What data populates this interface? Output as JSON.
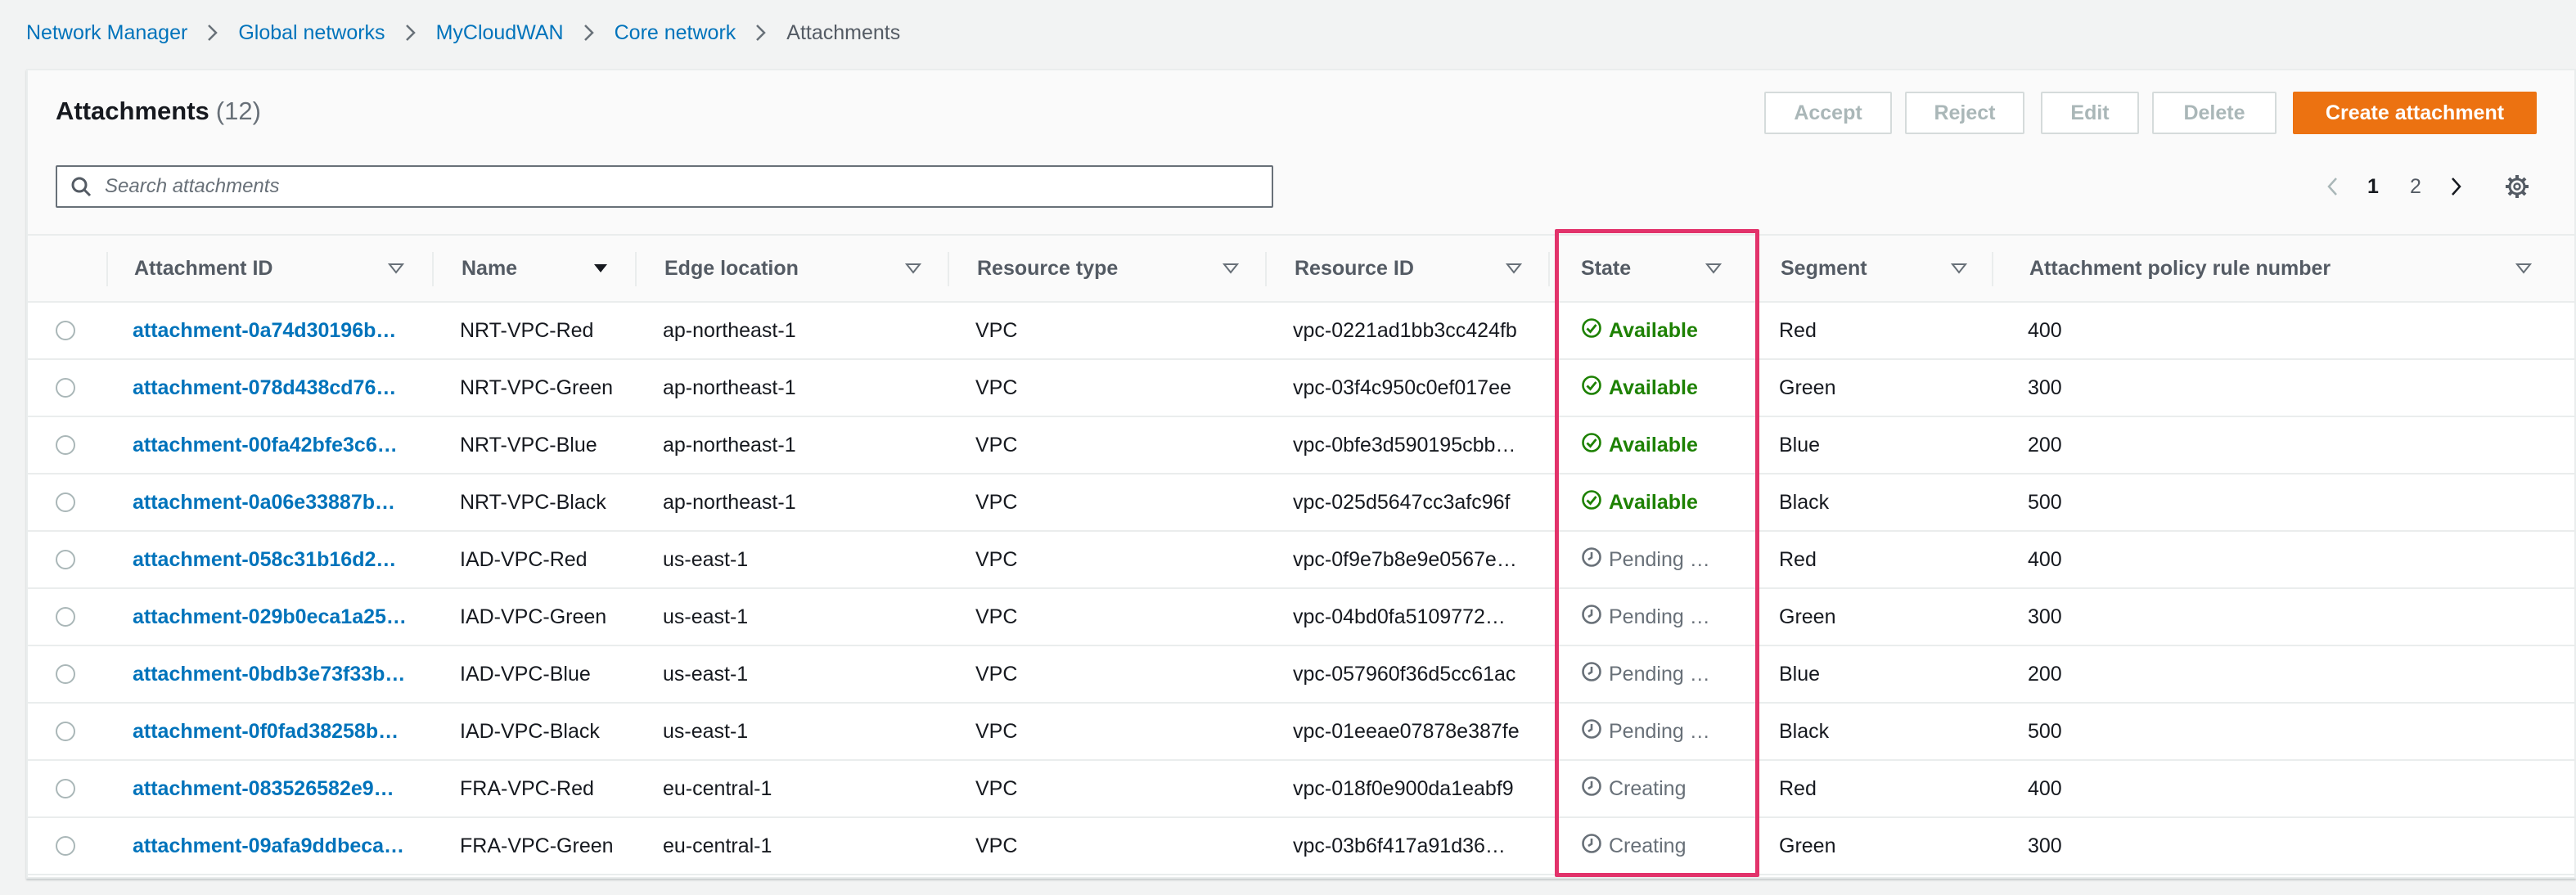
{
  "breadcrumb": {
    "items": [
      "Network Manager",
      "Global networks",
      "MyCloudWAN",
      "Core network"
    ],
    "current": "Attachments"
  },
  "panel": {
    "title": "Attachments",
    "count": "(12)"
  },
  "actions": {
    "accept": "Accept",
    "reject": "Reject",
    "edit": "Edit",
    "delete": "Delete",
    "create": "Create attachment"
  },
  "search": {
    "placeholder": "Search attachments"
  },
  "pagination": {
    "pages": [
      "1",
      "2"
    ],
    "current": "1"
  },
  "columns": {
    "attachment_id": "Attachment ID",
    "name": "Name",
    "edge_location": "Edge location",
    "resource_type": "Resource type",
    "resource_id": "Resource ID",
    "state": "State",
    "segment": "Segment",
    "policy_rule": "Attachment policy rule number"
  },
  "rows": [
    {
      "id": "attachment-0a74d30196b…",
      "name": "NRT-VPC-Red",
      "edge": "ap-northeast-1",
      "type": "VPC",
      "resource": "vpc-0221ad1bb3cc424fb",
      "state": "Available",
      "state_kind": "available",
      "segment": "Red",
      "rule": "400"
    },
    {
      "id": "attachment-078d438cd76…",
      "name": "NRT-VPC-Green",
      "edge": "ap-northeast-1",
      "type": "VPC",
      "resource": "vpc-03f4c950c0ef017ee",
      "state": "Available",
      "state_kind": "available",
      "segment": "Green",
      "rule": "300"
    },
    {
      "id": "attachment-00fa42bfe3c6…",
      "name": "NRT-VPC-Blue",
      "edge": "ap-northeast-1",
      "type": "VPC",
      "resource": "vpc-0bfe3d590195cbb…",
      "state": "Available",
      "state_kind": "available",
      "segment": "Blue",
      "rule": "200"
    },
    {
      "id": "attachment-0a06e33887b…",
      "name": "NRT-VPC-Black",
      "edge": "ap-northeast-1",
      "type": "VPC",
      "resource": "vpc-025d5647cc3afc96f",
      "state": "Available",
      "state_kind": "available",
      "segment": "Black",
      "rule": "500"
    },
    {
      "id": "attachment-058c31b16d2…",
      "name": "IAD-VPC-Red",
      "edge": "us-east-1",
      "type": "VPC",
      "resource": "vpc-0f9e7b8e9e0567e…",
      "state": "Pending …",
      "state_kind": "pending",
      "segment": "Red",
      "rule": "400"
    },
    {
      "id": "attachment-029b0eca1a25…",
      "name": "IAD-VPC-Green",
      "edge": "us-east-1",
      "type": "VPC",
      "resource": "vpc-04bd0fa5109772…",
      "state": "Pending …",
      "state_kind": "pending",
      "segment": "Green",
      "rule": "300"
    },
    {
      "id": "attachment-0bdb3e73f33b…",
      "name": "IAD-VPC-Blue",
      "edge": "us-east-1",
      "type": "VPC",
      "resource": "vpc-057960f36d5cc61ac",
      "state": "Pending …",
      "state_kind": "pending",
      "segment": "Blue",
      "rule": "200"
    },
    {
      "id": "attachment-0f0fad38258b…",
      "name": "IAD-VPC-Black",
      "edge": "us-east-1",
      "type": "VPC",
      "resource": "vpc-01eeae07878e387fe",
      "state": "Pending …",
      "state_kind": "pending",
      "segment": "Black",
      "rule": "500"
    },
    {
      "id": "attachment-083526582e9…",
      "name": "FRA-VPC-Red",
      "edge": "eu-central-1",
      "type": "VPC",
      "resource": "vpc-018f0e900da1eabf9",
      "state": "Creating",
      "state_kind": "pending",
      "segment": "Red",
      "rule": "400"
    },
    {
      "id": "attachment-09afa9ddbeca…",
      "name": "FRA-VPC-Green",
      "edge": "eu-central-1",
      "type": "VPC",
      "resource": "vpc-03b6f417a91d36…",
      "state": "Creating",
      "state_kind": "pending",
      "segment": "Green",
      "rule": "300"
    }
  ],
  "colors": {
    "link": "#0073bb",
    "primary_button": "#ec7211",
    "available": "#1d8102",
    "pending": "#687078",
    "highlight": "#e2336b"
  }
}
